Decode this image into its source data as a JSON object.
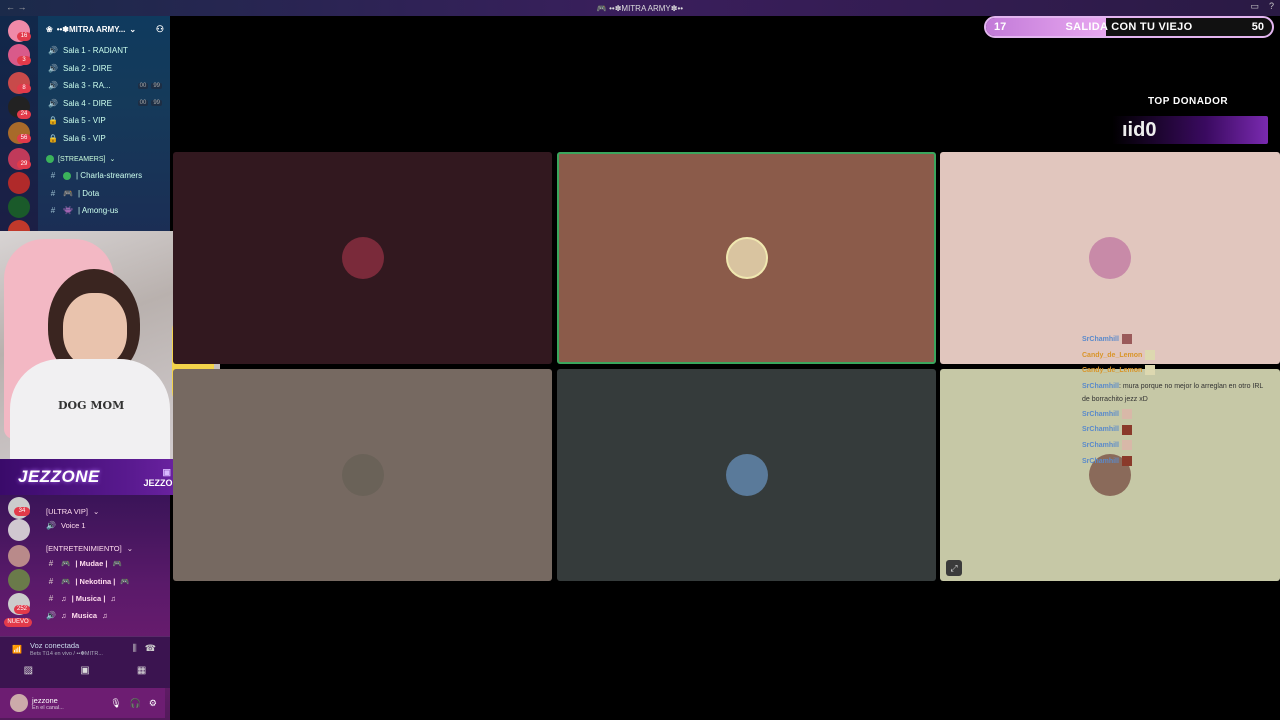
{
  "window": {
    "title": "🎮 ••✽MITRA ARMY✽••",
    "nav": "← →",
    "icons": [
      "inbox-icon",
      "help-icon"
    ]
  },
  "server_rail": {
    "badges": [
      "16",
      "3",
      "8",
      "24",
      "56",
      "29",
      "",
      "",
      ""
    ]
  },
  "sidebar": {
    "server_name": "••✽MITRA ARMY...",
    "channels": [
      {
        "name": "Sala 1 - RADIANT",
        "icon": "speaker-icon"
      },
      {
        "name": "Sala 2 - DIRE",
        "icon": "speaker-icon"
      },
      {
        "name": "Sala 3 - RA...",
        "icon": "speaker-icon",
        "meta": [
          "00",
          "99"
        ]
      },
      {
        "name": "Sala 4 - DIRE",
        "icon": "speaker-icon",
        "meta": [
          "00",
          "99"
        ]
      },
      {
        "name": "Sala 5 - VIP",
        "icon": "lock-icon"
      },
      {
        "name": "Sala 6 - VIP",
        "icon": "lock-icon"
      }
    ],
    "category_streamers": "[STREAMERS]",
    "streamer_channels": [
      {
        "name": "| Charla-streamers"
      },
      {
        "name": "| Dota"
      },
      {
        "name": "| Among-us"
      }
    ]
  },
  "overlay": {
    "brand_logo": "JEZZONE",
    "twitch_handle": "JEZZONE_",
    "webcam_shirt": "DOG MOM",
    "donation": {
      "min": "17",
      "goal": "SALIDA CON TU VIEJO",
      "max": "50",
      "progress": 0.42
    },
    "top_donor_label": "TOP DONADOR",
    "top_donor_name": "ıid0"
  },
  "lower_sidebar": {
    "badges": [
      "34",
      "",
      "",
      "",
      "252"
    ],
    "new_badge": "NUEVO",
    "category_ultravip": "[ULTRA VIP]",
    "voice1": "Voice 1",
    "category_entretenimiento": "[ENTRETENIMIENTO]",
    "ent_channels": [
      {
        "name": "| Mudae |",
        "icon": "hash-icon"
      },
      {
        "name": "| Nekotina |",
        "icon": "hash-icon"
      },
      {
        "name": "| Musica |",
        "icon": "hash-icon"
      },
      {
        "name": "Musica",
        "icon": "speaker-icon"
      }
    ]
  },
  "voice_panel": {
    "status": "Voz conectada",
    "subtitle": "Bets Ti14 en vivo / ••✽MITR..."
  },
  "user": {
    "name": "jezzone",
    "status": "En el canal..."
  },
  "chat": [
    {
      "user": "SrChamhill",
      "msg": ""
    },
    {
      "user": "Candy_de_Lemon",
      "msg": "",
      "alt": true
    },
    {
      "user": "Candy_de_Lemon",
      "msg": "",
      "alt": true
    },
    {
      "user": "SrChamhill",
      "msg": ": mura porque no mejor lo arreglan en otro IRL de borrachito jezz xD"
    },
    {
      "user": "SrChamhill",
      "msg": ""
    },
    {
      "user": "SrChamhill",
      "msg": ""
    },
    {
      "user": "SrChamhill",
      "msg": ""
    },
    {
      "user": "SrChamhill",
      "msg": ""
    }
  ],
  "tiles": [
    {
      "bg": "#32181f",
      "av": "#7a2a3a"
    },
    {
      "bg": "#8b5b4a",
      "av": "#d9c4a0",
      "active": true
    },
    {
      "bg": "#e1c6be",
      "av": "#c88aa8"
    },
    {
      "bg": "#766961",
      "av": "#6a6258"
    },
    {
      "bg": "#353b3b",
      "av": "#5a7a9a"
    },
    {
      "bg": "#c6c8a6",
      "av": "#8a6a5a"
    }
  ]
}
